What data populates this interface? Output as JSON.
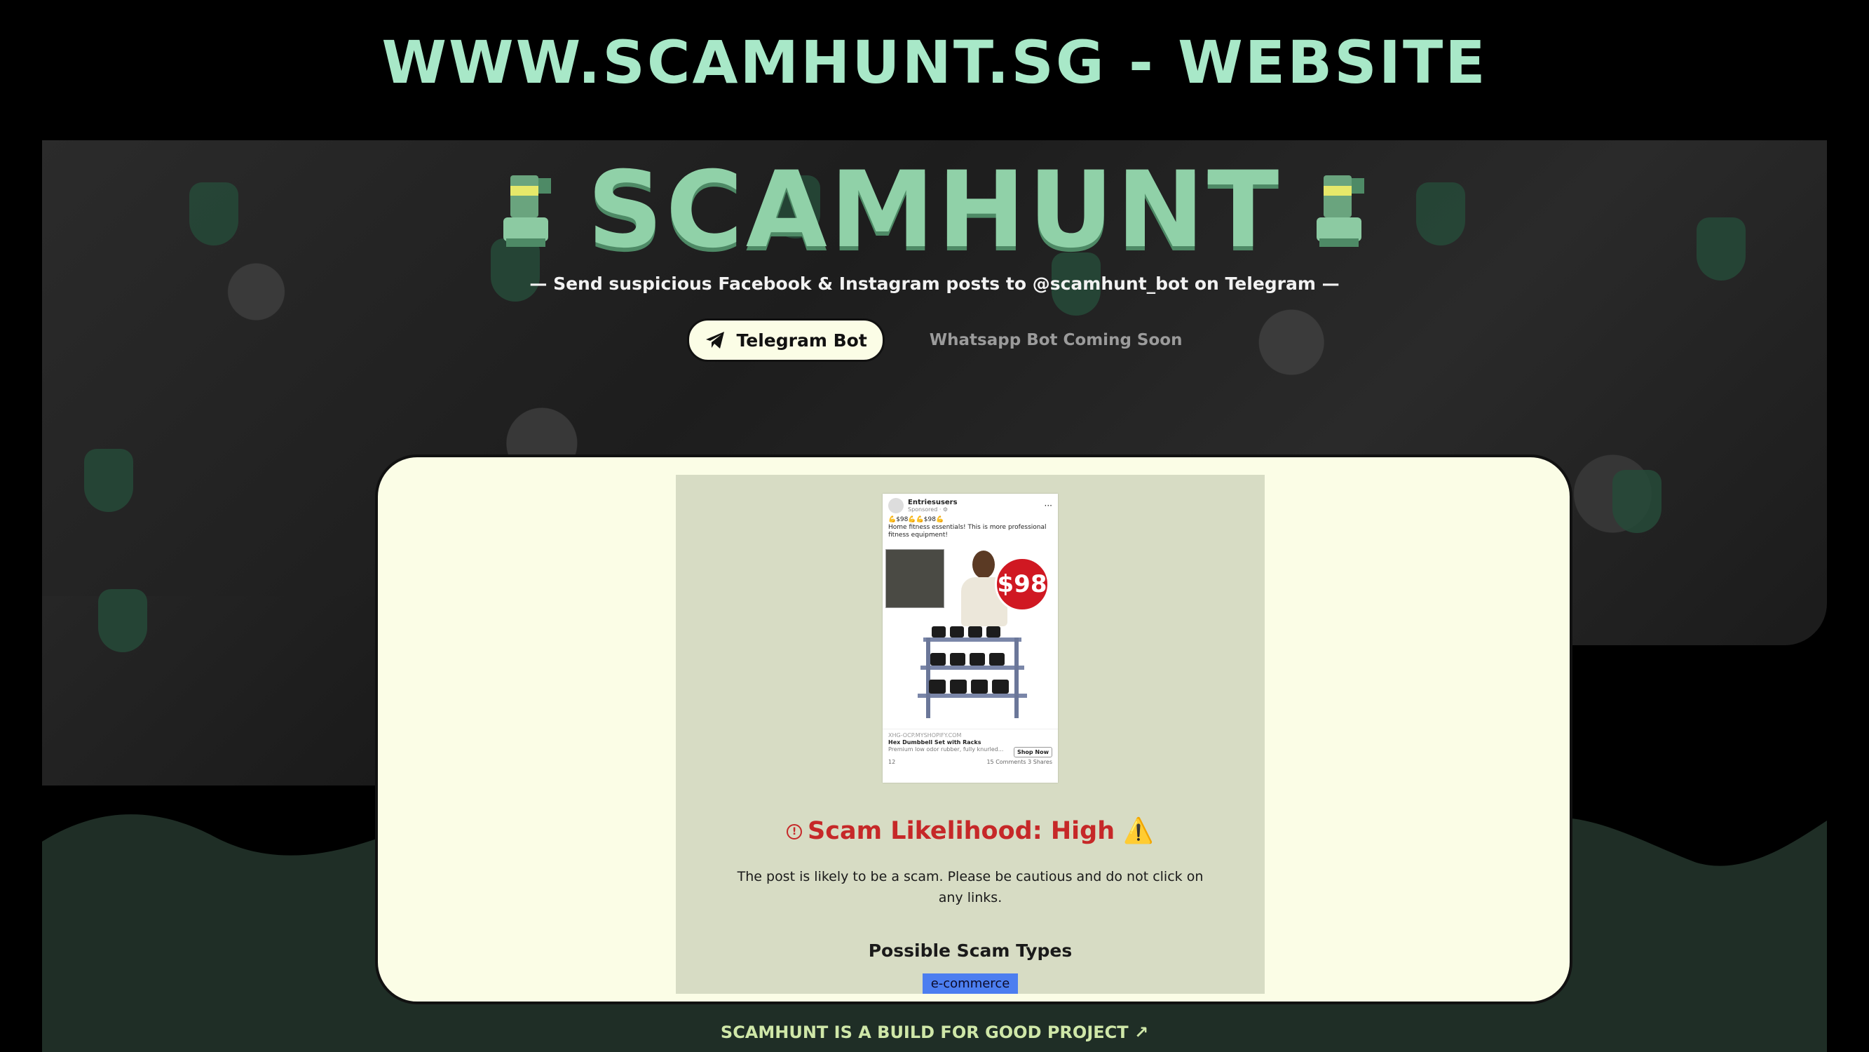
{
  "slide_title": "WWW.SCAMHUNT.SG - WEBSITE",
  "site": {
    "logo_text": "SCAMHUNT",
    "tagline": "— Send suspicious Facebook & Instagram posts to @scamhunt_bot on Telegram —",
    "telegram_button": "Telegram Bot",
    "whatsapp_text": "Whatsapp Bot Coming Soon",
    "footer_link": "SCAMHUNT IS A BUILD FOR GOOD PROJECT ↗"
  },
  "ad_post": {
    "page_name": "Entriesusers",
    "sponsored": "Sponsored · ⚙",
    "headline": "💪$98💪💪$98💪",
    "body": "Home fitness essentials! This is more professional fitness equipment!",
    "price_badge": "$98",
    "site": "XHG-OCP.MYSHOPIFY.COM",
    "product_title": "Hex Dumbbell Set with Racks",
    "product_desc": "Premium low odor rubber, fully knurled...",
    "cta": "Shop Now",
    "reactions": "12",
    "comments": "15 Comments",
    "shares": "3 Shares"
  },
  "result": {
    "likelihood_label": "Scam Likelihood: High",
    "warning_icon": "⚠️",
    "description": "The post is likely to be a scam. Please be cautious and do not click on any links.",
    "types_title": "Possible Scam Types",
    "types": [
      "e-commerce"
    ]
  },
  "colors": {
    "title_mint": "#a8e8c8",
    "logo_green": "#90d1a8",
    "card_cream": "#fbfde6",
    "panel_sage": "#d7dcc4",
    "danger_red": "#c62828",
    "chip_blue": "#4c7ef0",
    "wave_green": "#1f2e26"
  }
}
